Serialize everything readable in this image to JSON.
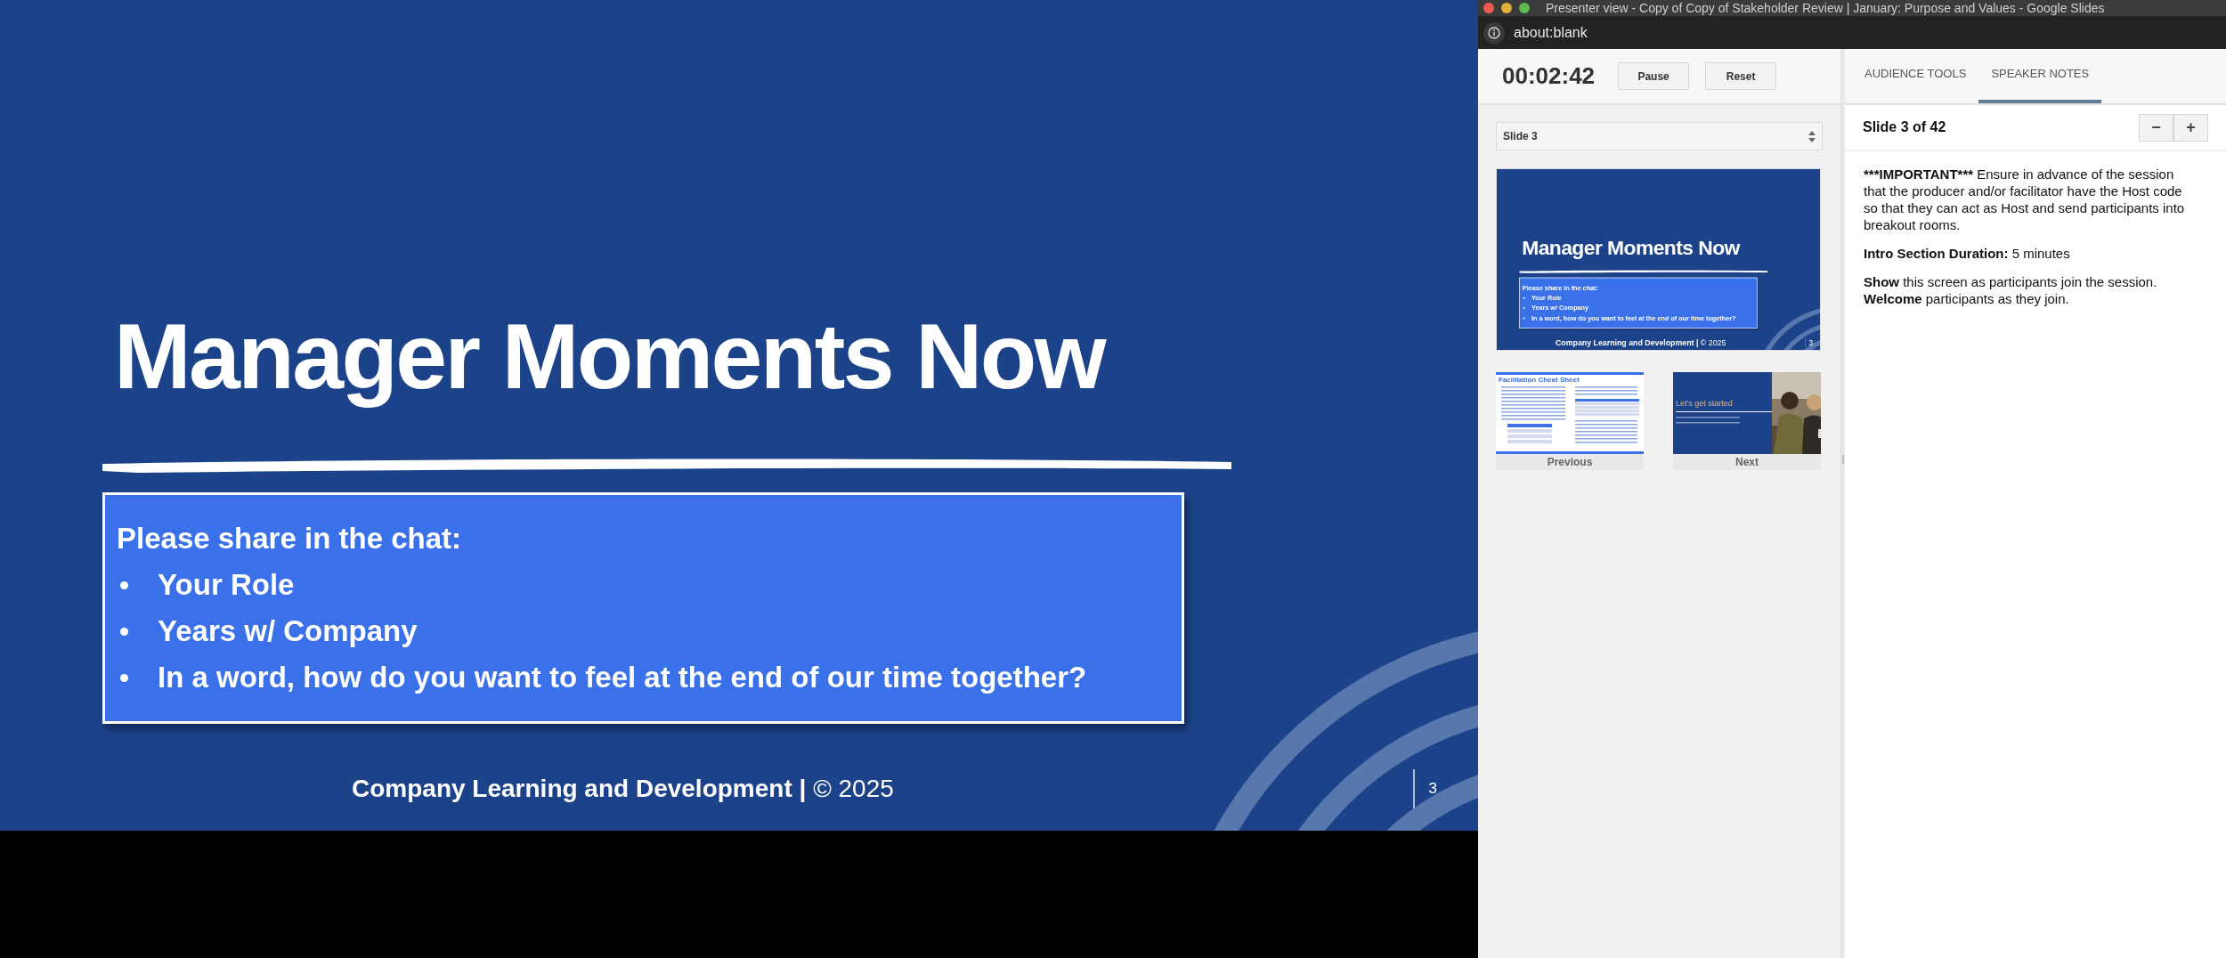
{
  "main_slide": {
    "title": "Manager Moments Now",
    "box_heading": "Please share in the chat:",
    "bullets": [
      "Your Role",
      "Years w/ Company",
      "In a word, how do you want to feel at the end of our time together?"
    ],
    "footer": "**Company Learning and Development |** © 2025",
    "page_number": "3"
  },
  "window": {
    "title": "Presenter view - Copy of Copy of Stakeholder Review | January: Purpose and Values - Google Slides",
    "address": "about:blank"
  },
  "timer": {
    "time": "00:02:42",
    "buttons": [
      "Pause",
      "Reset"
    ]
  },
  "slide_select": {
    "value": "Slide 3"
  },
  "current_thumbnail": {
    "title": "Manager Moments Now",
    "box_heading": "Please share in the chat:",
    "bullets": [
      "Your Role",
      "Years w/ Company",
      "In a word, how do you want to feel at the end of our time together?"
    ],
    "footer": "**Company Learning and Development |** © 2025",
    "page_number": "3"
  },
  "nav_thumbnails": [
    {
      "kind": "document",
      "title": "Facilitation Cheat Sheet",
      "label": "Previous"
    },
    {
      "title": "Let’s get started",
      "label": "Next"
    }
  ],
  "tabs": [
    {
      "label": "AUDIENCE TOOLS",
      "selected": false
    },
    {
      "label": "SPEAKER NOTES",
      "selected": true
    }
  ],
  "notes": {
    "slide_count": "Slide 3 of 42",
    "zoom_buttons": [
      "−",
      "+"
    ],
    "paragraphs": [
      [
        {
          "text": "***IMPORTANT***",
          "bold": true
        },
        {
          "text": " Ensure in advance of the session that the producer and/or facilitator have the Host code so that they can act as Host and send participants into breakout rooms.",
          "bold": false
        }
      ],
      [
        {
          "text": "Intro Section Duration:",
          "bold": true
        },
        {
          "text": " 5 minutes",
          "bold": false
        }
      ],
      [
        {
          "text": "Show",
          "bold": true
        },
        {
          "text": " this screen as participants join the session. ",
          "bold": false
        },
        {
          "text": "Welcome",
          "bold": true
        },
        {
          "text": " participants as they join.",
          "bold": false
        }
      ]
    ]
  }
}
